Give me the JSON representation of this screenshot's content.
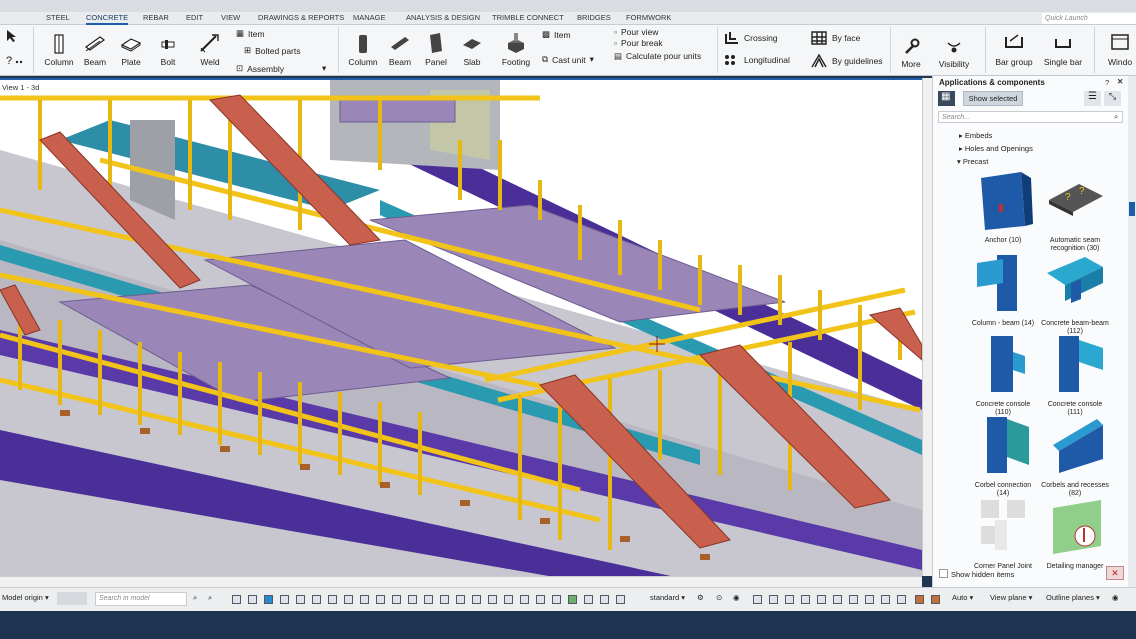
{
  "menu": {
    "tabs": [
      "STEEL",
      "CONCRETE",
      "REBAR",
      "EDIT",
      "VIEW",
      "DRAWINGS & REPORTS",
      "MANAGE",
      "ANALYSIS & DESIGN",
      "TRIMBLE CONNECT",
      "BRIDGES",
      "FORMWORK"
    ],
    "active_tab": "CONCRETE",
    "quick_launch_placeholder": "Quick Launch"
  },
  "ribbon": {
    "steel": {
      "column": "Column",
      "beam": "Beam",
      "plate": "Plate",
      "bolt": "Bolt",
      "weld": "Weld",
      "item": "Item",
      "bolted_parts": "Bolted parts",
      "assembly": "Assembly"
    },
    "concrete": {
      "column": "Column",
      "beam": "Beam",
      "panel": "Panel",
      "slab": "Slab",
      "footing": "Footing",
      "item": "Item",
      "cast_unit": "Cast unit",
      "pour_view": "Pour view",
      "pour_break": "Pour break",
      "calculate_pour_units": "Calculate pour units"
    },
    "rebar": {
      "crossing": "Crossing",
      "by_face": "By face",
      "longitudinal": "Longitudinal",
      "by_guidelines": "By guidelines"
    },
    "more": "More",
    "visibility": "Visibility",
    "bar_group": "Bar group",
    "single_bar": "Single bar",
    "window": "Windo"
  },
  "viewport": {
    "title": "View 1 - 3d"
  },
  "panel": {
    "title": "Applications & components",
    "show_selected": "Show selected",
    "search_placeholder": "Search...",
    "tree": [
      "Embeds",
      "Holes and Openings",
      "Precast"
    ],
    "components": [
      {
        "label": "Anchor (10)"
      },
      {
        "label": "Automatic seam recognition (30)"
      },
      {
        "label": "Column - beam (14)"
      },
      {
        "label": "Concrete beam-beam (112)"
      },
      {
        "label": "Concrete console (110)"
      },
      {
        "label": "Concrete console (111)"
      },
      {
        "label": "Corbel connection (14)"
      },
      {
        "label": "Corbels and recesses (82)"
      },
      {
        "label": "Corner Panel Joint"
      },
      {
        "label": "Detailing manager"
      }
    ],
    "show_hidden": "Show hidden items"
  },
  "statusbar": {
    "model_origin": "Model origin",
    "search_placeholder": "Search in model",
    "standard": "standard",
    "auto": "Auto",
    "view_plane": "View plane",
    "outline_planes": "Outline planes"
  },
  "colors": {
    "accent": "#1b5faa",
    "steel_yellow": "#f2c318",
    "slab_purple": "#9b86b8",
    "stair_red": "#c9604e",
    "floor_teal": "#2a9ab0",
    "base_indigo": "#4a2f99"
  }
}
